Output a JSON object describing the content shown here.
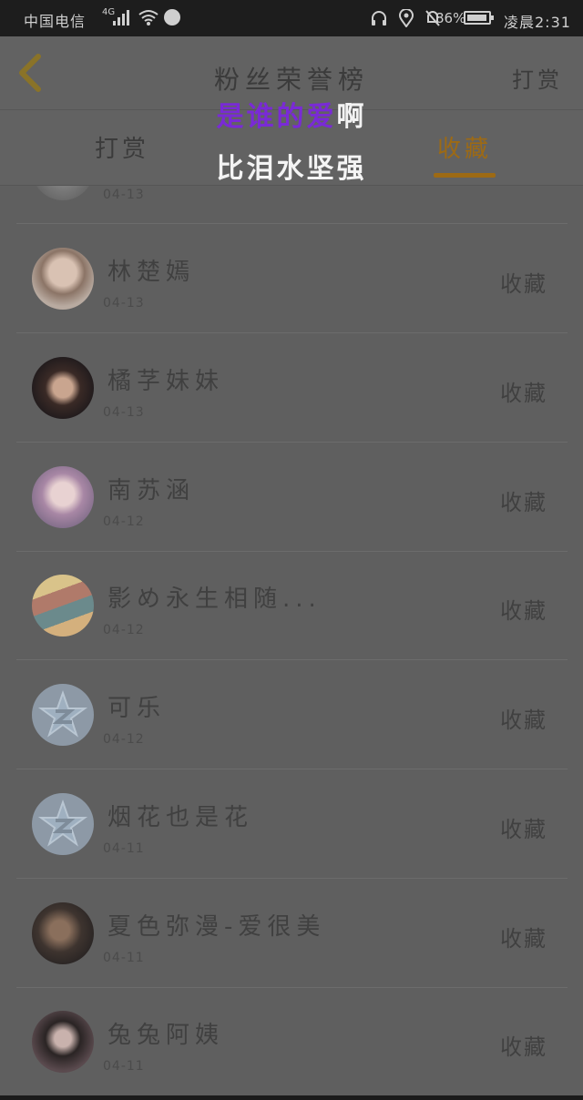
{
  "status_bar": {
    "carrier": "中国电信",
    "network": "4G",
    "battery_pct": "86%",
    "time": "凌晨2:31"
  },
  "header": {
    "title": "粉丝荣誉榜",
    "right_action": "打赏"
  },
  "tabs": [
    {
      "label": "打赏"
    },
    {
      "label": "收藏",
      "active": true
    }
  ],
  "lyric": {
    "line1_highlight": "是谁的爱",
    "line1_rest": "啊",
    "line2": "比泪水坚强"
  },
  "list": {
    "partial_item": {
      "date": "04-13"
    },
    "items": [
      {
        "name": "林楚嫣",
        "date": "04-13",
        "action": "收藏"
      },
      {
        "name": "橘芓妹妹",
        "date": "04-13",
        "action": "收藏"
      },
      {
        "name": "南苏涵",
        "date": "04-12",
        "action": "收藏"
      },
      {
        "name": "影め永生相随...",
        "date": "04-12",
        "action": "收藏"
      },
      {
        "name": "可乐",
        "date": "04-12",
        "action": "收藏"
      },
      {
        "name": "烟花也是花",
        "date": "04-11",
        "action": "收藏"
      },
      {
        "name": "夏色弥漫-爱很美",
        "date": "04-11",
        "action": "收藏"
      },
      {
        "name": "兔兔阿姨",
        "date": "04-11",
        "action": "收藏"
      }
    ]
  },
  "colors": {
    "accent": "#9d6a14",
    "lyric_highlight": "#7a2ad6"
  }
}
